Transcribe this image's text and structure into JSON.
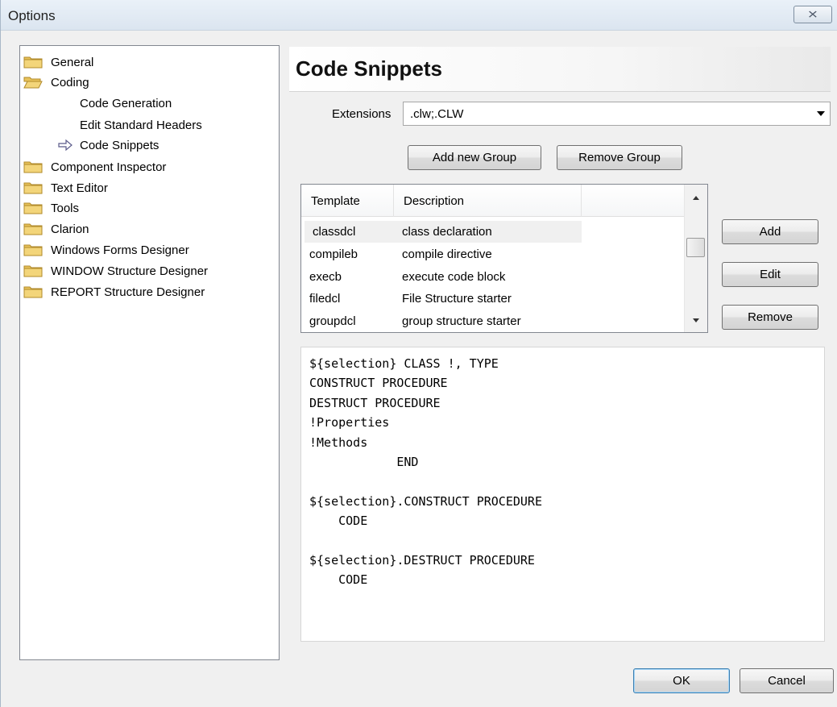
{
  "window": {
    "title": "Options",
    "close_symbol": "⨯"
  },
  "tree": {
    "items": [
      {
        "label": "General",
        "icon": "folder-closed-icon"
      },
      {
        "label": "Coding",
        "icon": "folder-open-icon"
      },
      {
        "label": "Code Generation",
        "icon": ""
      },
      {
        "label": "Edit Standard Headers",
        "icon": ""
      },
      {
        "label": "Code Snippets",
        "icon": "arrow-right-icon"
      },
      {
        "label": "Component Inspector",
        "icon": "folder-closed-icon"
      },
      {
        "label": "Text Editor",
        "icon": "folder-closed-icon"
      },
      {
        "label": "Tools",
        "icon": "folder-closed-icon"
      },
      {
        "label": "Clarion",
        "icon": "folder-closed-icon"
      },
      {
        "label": "Windows Forms Designer",
        "icon": "folder-closed-icon"
      },
      {
        "label": "WINDOW Structure Designer",
        "icon": "folder-closed-icon"
      },
      {
        "label": "REPORT Structure Designer",
        "icon": "folder-closed-icon"
      }
    ]
  },
  "panel": {
    "title": "Code Snippets",
    "extensions_label": "Extensions",
    "extensions_value": ".clw;.CLW",
    "add_group_label": "Add new Group",
    "remove_group_label": "Remove Group",
    "add_label": "Add",
    "edit_label": "Edit",
    "remove_label": "Remove"
  },
  "list": {
    "columns": [
      "Template",
      "Description"
    ],
    "rows": [
      {
        "template": "classdcl",
        "description": "class declaration"
      },
      {
        "template": "compileb",
        "description": "compile directive"
      },
      {
        "template": "execb",
        "description": "execute code block"
      },
      {
        "template": "filedcl",
        "description": "File Structure starter"
      },
      {
        "template": "groupdcl",
        "description": "group structure starter"
      }
    ],
    "selected_index": 0
  },
  "code": {
    "text": "${selection} CLASS !, TYPE\nCONSTRUCT PROCEDURE\nDESTRUCT PROCEDURE\n!Properties\n!Methods\n            END\n\n${selection}.CONSTRUCT PROCEDURE\n    CODE\n\n${selection}.DESTRUCT PROCEDURE\n    CODE"
  },
  "footer": {
    "ok_label": "OK",
    "cancel_label": "Cancel"
  },
  "colors": {
    "folder": "#e8c25a",
    "selection": "#f0f0f0",
    "default_button_border": "#3c7fb1"
  }
}
